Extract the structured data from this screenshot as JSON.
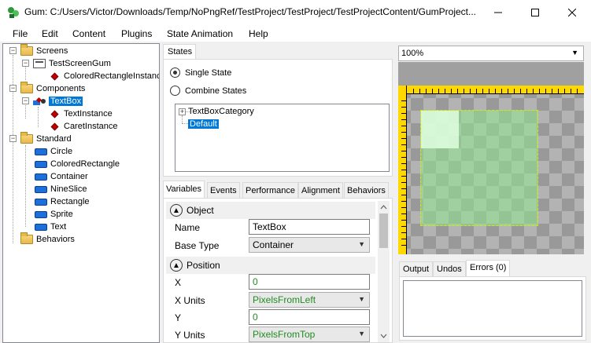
{
  "window": {
    "title": "Gum: C:/Users/Victor/Downloads/Temp/NoPngRef/TestProject/TestProject/TestProjectContent/GumProject..."
  },
  "menu": {
    "items": [
      "File",
      "Edit",
      "Content",
      "Plugins",
      "State Animation",
      "Help"
    ]
  },
  "tree": {
    "screens": "Screens",
    "test_screen": "TestScreenGum",
    "colored_rect_instance": "ColoredRectangleInstance",
    "components": "Components",
    "textbox": "TextBox",
    "text_instance": "TextInstance",
    "caret_instance": "CaretInstance",
    "standard": "Standard",
    "standard_items": [
      "Circle",
      "ColoredRectangle",
      "Container",
      "NineSlice",
      "Rectangle",
      "Sprite",
      "Text"
    ],
    "behaviors": "Behaviors"
  },
  "states": {
    "tab_label": "States",
    "single_state": "Single State",
    "combine_states": "Combine States",
    "category": "TextBoxCategory",
    "default_state": "Default"
  },
  "variables": {
    "tabs": [
      "Variables",
      "Events",
      "Performance",
      "Alignment",
      "Behaviors"
    ],
    "object_section": "Object",
    "name_label": "Name",
    "name_value": "TextBox",
    "base_type_label": "Base Type",
    "base_type_value": "Container",
    "position_section": "Position",
    "x_label": "X",
    "x_value": "0",
    "x_units_label": "X Units",
    "x_units_value": "PixelsFromLeft",
    "y_label": "Y",
    "y_value": "0",
    "y_units_label": "Y Units",
    "y_units_value": "PixelsFromTop"
  },
  "preview": {
    "zoom": "100%"
  },
  "output": {
    "tabs": [
      "Output",
      "Undos",
      "Errors (0)"
    ]
  }
}
